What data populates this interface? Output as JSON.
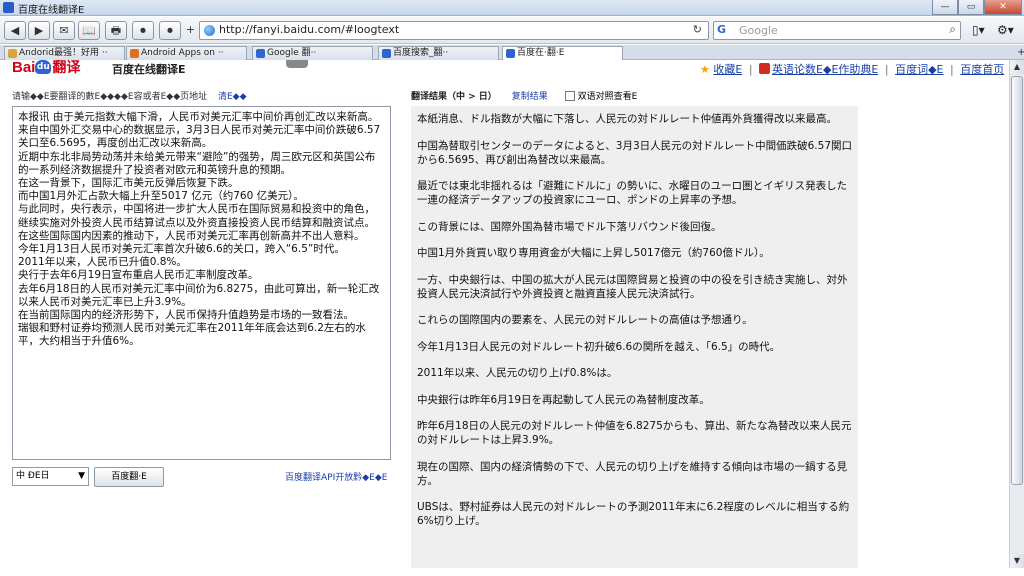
{
  "window": {
    "title": "百度在线翻译E",
    "buttons": [
      "—",
      "▭",
      "✕"
    ]
  },
  "toolbar": {
    "url": "http://fanyi.baidu.com/#loogtext",
    "reload_icon": "↻",
    "search_placeholder": "Google",
    "search_engine_label": "G",
    "page_menu": "▯▾",
    "tools_menu": "⚙▾",
    "buttons": [
      "◀",
      "▶",
      "✉",
      "📖",
      "🖶",
      "⏺",
      "⏺",
      "+"
    ]
  },
  "tabs": [
    {
      "label": "Andorid最强！好用 ··",
      "icon_color": "#d9a43a",
      "active": false
    },
    {
      "label": "Android Apps on ··",
      "icon_color": "#e07020",
      "active": false
    },
    {
      "label": "Google 翻··",
      "icon_color": "#3366cc",
      "active": false
    },
    {
      "label": "百度搜索_翻··",
      "icon_color": "#2e64d0",
      "active": false
    },
    {
      "label": "百度在·翻·E",
      "icon_color": "#2e64d0",
      "active": true
    }
  ],
  "header": {
    "logo_text": "Bai",
    "logo_paw": "du",
    "logo_fanyi": "翻译",
    "page_title": "百度在线翻译E",
    "links": [
      "收藏E",
      "英语论数E◆E作助典E",
      "百度词◆E",
      "百度首页"
    ]
  },
  "source": {
    "header_label": "请输◆◆E要翻译的數E◆◆◆◆E容或者E◆◆页地址",
    "clear_link": "清E◆◆",
    "paragraphs": [
      "本报讯 由于美元指数大幅下滑，人民币对美元汇率中间价再创汇改以来新高。",
      "来自中国外汇交易中心的数据显示，3月3日人民币对美元汇率中间价跌破6.57关口至6.5695，再度创出汇改以来新高。",
      "近期中东北非局势动荡并未给美元带来“避险”的强势，周三欧元区和英国公布的一系列经济数据提升了投资者对欧元和英镑升息的预期。",
      "在这一背景下，国际汇市美元反弹后恢复下跌。",
      "而中国1月外汇占款大幅上升至5017 亿元（约760 亿美元）。",
      "与此同时，央行表示，中国将进一步扩大人民币在国际贸易和投资中的角色，继续实施对外投资人民币结算试点以及外资直接投资人民币结算和融资试点。",
      "在这些国际国内因素的推动下，人民币对美元汇率再创新高并不出人意料。",
      "今年1月13日人民币对美元汇率首次升破6.6的关口，跨入“6.5”时代。",
      "2011年以来，人民币已升值0.8%。",
      "央行于去年6月19日宣布重启人民币汇率制度改革。",
      "去年6月18日的人民币对美元汇率中间价为6.8275，由此可算出，新一轮汇改以来人民币对美元汇率已上升3.9%。",
      "在当前国际国内的经济形势下，人民币保持升值趋势是市场的一致看法。",
      "瑞银和野村证券均预测人民币对美元汇率在2011年年底会达到6.2左右的水平，大约相当于升值6%。"
    ],
    "lang_select": "中 ÐE日",
    "lang_arrow": "▼",
    "translate_button": "百度翻·E",
    "api_link": "百度翻译API开放黔◆E◆E"
  },
  "result": {
    "header_label": "翻译结果（中 > 日）",
    "copy_link": "复制结果",
    "compare_label": "双语对照查看E",
    "paragraphs": [
      "本紙消息、ドル指数が大幅に下落し、人民元の対ドルレート仲値再外貨獲得改以来最高。",
      "中国為替取引センターのデータによると、3月3日人民元の対ドルレート中間価跌破6.57関口から6.5695、再び創出為替改以来最高。",
      "最近では東北非揺れるは「避難にドルに」の勢いに、水曜日のユーロ圏とイギリス発表した一連の経済データアップの投資家にユーロ、ポンドの上昇率の予想。",
      "この背景には、国際外国為替市場でドル下落リバウンド後回復。",
      "中国1月外貨買い取り専用資金が大幅に上昇し5017億元（約760億ドル）。",
      "一方、中央銀行は、中国の拡大が人民元は国際貿易と投資の中の役を引き続き実施し、対外投資人民元決済試行や外資投資と融資直接人民元決済試行。",
      "これらの国際国内の要素を、人民元の対ドルレートの高値は予想通り。",
      "今年1月13日人民元の対ドルレート初升破6.6の関所を越え、「6.5」の時代。",
      "2011年以来、人民元の切り上げ0.8%は。",
      "中央銀行は昨年6月19日を再起動して人民元の為替制度改革。",
      "昨年6月18日の人民元の対ドルレート仲値を6.8275からも、算出、新たな為替改以来人民元の対ドルレートは上昇3.9%。",
      "現在の国際、国内の経済情勢の下で、人民元の切り上げを維持する傾向は市場の一鍋する見方。",
      "UBSは、野村証券は人民元の対ドルレートの予測2011年末に6.2程度のレベルに相当する約6%切り上げ。"
    ]
  },
  "scrollbar": {
    "up": "▲",
    "down": "▼"
  }
}
